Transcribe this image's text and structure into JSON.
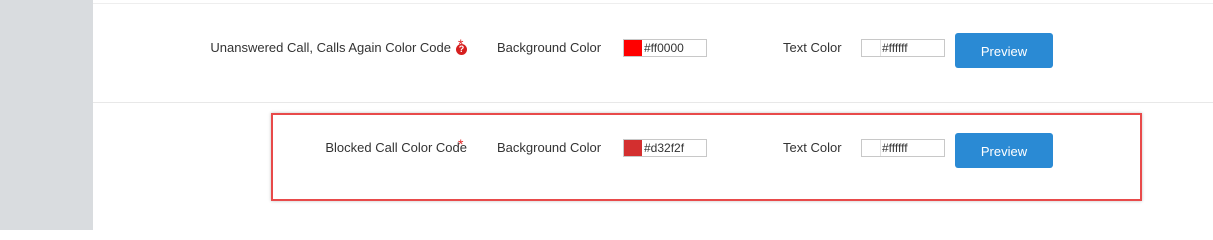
{
  "rows": [
    {
      "label": "Unanswered Call, Calls Again Color Code",
      "has_help_icon": true,
      "help_icon": "question-icon",
      "required": "*",
      "background_label": "Background Color",
      "background_value": "#ff0000",
      "text_label": "Text Color",
      "text_value": "#ffffff",
      "preview_label": "Preview"
    },
    {
      "label": "Blocked Call Color Code",
      "has_help_icon": false,
      "required": "*",
      "background_label": "Background Color",
      "background_value": "#d32f2f",
      "text_label": "Text Color",
      "text_value": "#ffffff",
      "preview_label": "Preview"
    }
  ],
  "help_icon_glyph": "?",
  "colors": {
    "accent": "#2a8ad4",
    "required": "#e02424",
    "highlight": "#e84a4a",
    "sidebar": "#d9dcdf"
  }
}
